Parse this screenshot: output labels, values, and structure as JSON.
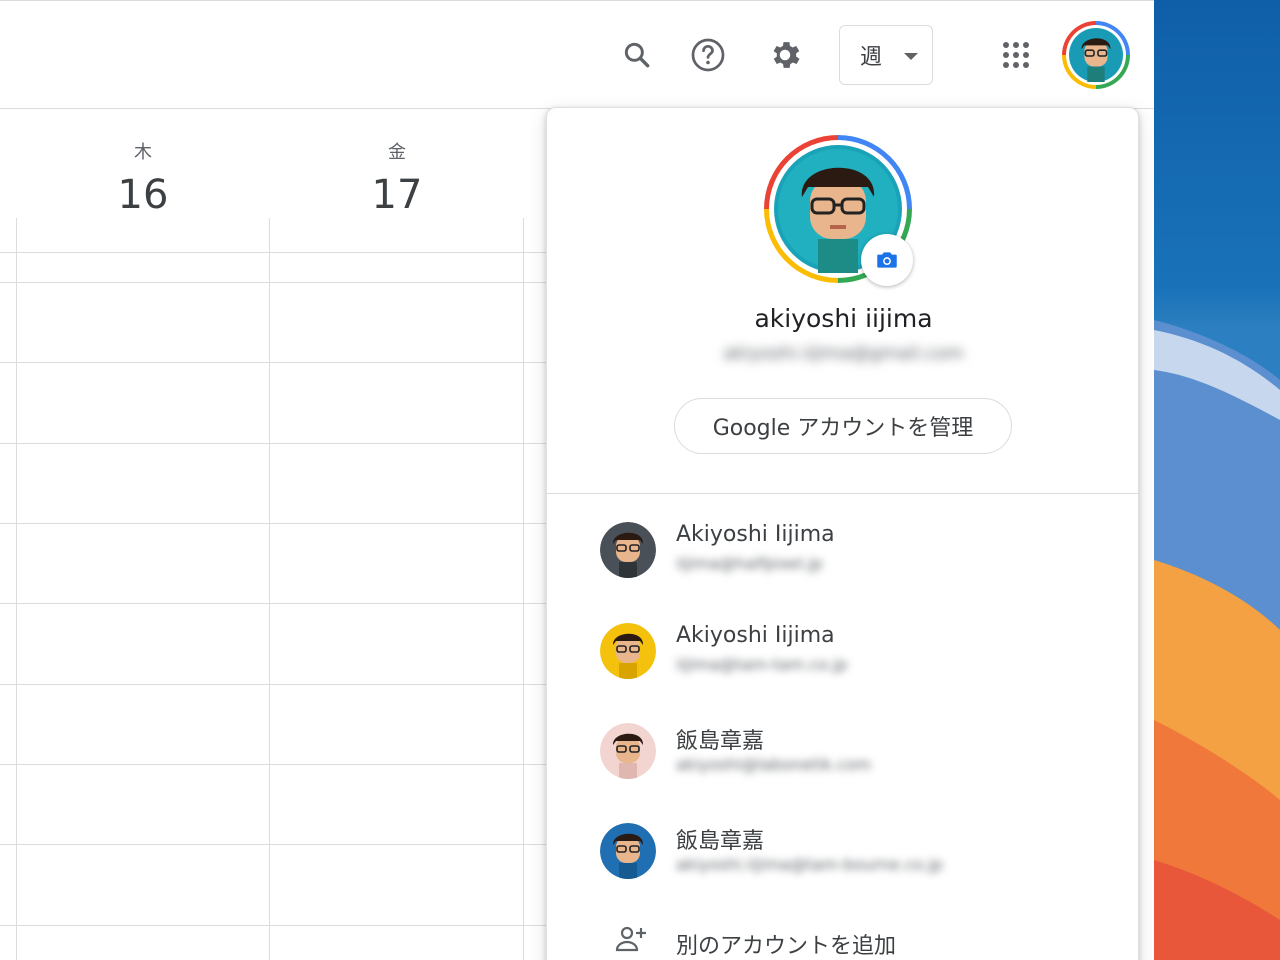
{
  "header": {
    "view_selector": {
      "label": "週"
    },
    "icons": [
      "search-icon",
      "help-icon",
      "settings-icon",
      "apps-grid-icon"
    ]
  },
  "calendar": {
    "days": [
      {
        "dow": "木",
        "date": "16"
      },
      {
        "dow": "金",
        "date": "17"
      }
    ]
  },
  "account_menu": {
    "current": {
      "name": "akiyoshi iijima",
      "email": "akiyoshi.iijima@gmail.com"
    },
    "manage_button": "Google アカウントを管理",
    "accounts": [
      {
        "name": "Akiyoshi Iijima",
        "email": "iijima@halfpixel.jp",
        "avatar_bg": "#4a5058"
      },
      {
        "name": "Akiyoshi Iijima",
        "email": "iijima@tam-tam.co.jp",
        "avatar_bg": "#f4c20d"
      },
      {
        "name": "飯島章嘉",
        "email": "akiyoshi@labonetik.com",
        "avatar_bg": "#f2d4d0"
      },
      {
        "name": "飯島章嘉",
        "email": "akiyoshi.iijima@tam-bourne.co.jp",
        "avatar_bg": "#1f6fb2"
      }
    ],
    "add_account": "別のアカウントを追加"
  },
  "colors": {
    "google_blue": "#4285f4",
    "google_green": "#34a853",
    "google_yellow": "#fbbc04",
    "google_red": "#ea4335"
  }
}
